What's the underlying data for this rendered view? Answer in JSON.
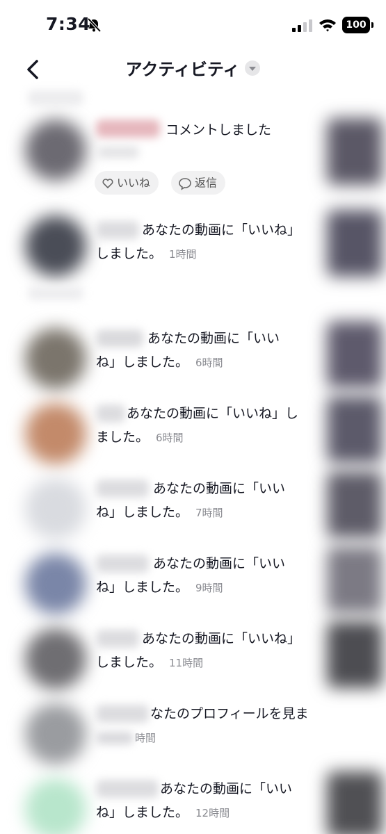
{
  "status_bar": {
    "time": "7:34",
    "battery": "100"
  },
  "header": {
    "title": "アクティビティ"
  },
  "colors": {
    "background": "#ffffff",
    "text": "#161823",
    "secondary_text": "#8a8b91",
    "chip_bg": "#f1f1f2"
  },
  "items": [
    {
      "line1": "コメントしました",
      "line2": "",
      "time": ""
    },
    {
      "line1": "あなたの動画に「いいね」",
      "line2": "しました。",
      "time": "1時間"
    },
    {
      "line1": "あなたの動画に「いい",
      "line2": "ね」しました。",
      "time": "6時間"
    },
    {
      "line1": "あなたの動画に「いいね」し",
      "line2": "ました。",
      "time": "6時間"
    },
    {
      "line1": "あなたの動画に「いい",
      "line2": "ね」しました。",
      "time": "7時間"
    },
    {
      "line1": "あなたの動画に「いい",
      "line2": "ね」しました。",
      "time": "9時間"
    },
    {
      "line1": "あなたの動画に「いいね」",
      "line2": "しました。",
      "time": "11時間"
    },
    {
      "line1": "なたのプロフィールを見ま",
      "line2": "",
      "time": "時間"
    },
    {
      "line1": "あなたの動画に「いい",
      "line2": "ね」しました。",
      "time": "12時間"
    }
  ],
  "comment_actions": {
    "like_label": "いいね",
    "reply_label": "返信"
  }
}
